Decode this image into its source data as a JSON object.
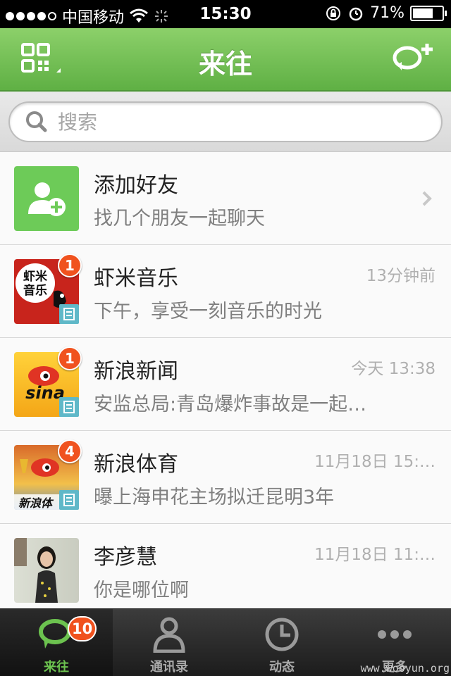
{
  "status_bar": {
    "carrier": "中国移动",
    "time": "15:30",
    "battery": "71%",
    "battery_level": 0.71
  },
  "navbar": {
    "title": "来往"
  },
  "search": {
    "placeholder": "搜索"
  },
  "conversations": [
    {
      "title": "添加好友",
      "subtitle": "找几个朋友一起聊天",
      "time": ""
    },
    {
      "title": "虾米音乐",
      "subtitle": "下午，享受一刻音乐的时光",
      "time": "13分钟前",
      "badge": "1",
      "avatar_text": "虾米\n音乐"
    },
    {
      "title": "新浪新闻",
      "subtitle": "安监总局:青岛爆炸事故是一起…",
      "time": "今天 13:38",
      "badge": "1",
      "avatar_text": "sina"
    },
    {
      "title": "新浪体育",
      "subtitle": "曝上海申花主场拟迁昆明3年",
      "time": "11月18日 15:…",
      "badge": "4",
      "avatar_text": "新浪体"
    },
    {
      "title": "李彦慧",
      "subtitle": "你是哪位啊",
      "time": "11月18日 11:…"
    }
  ],
  "tabs": [
    {
      "label": "来往",
      "badge": "10",
      "icon": "chat-bubble-icon"
    },
    {
      "label": "通讯录",
      "icon": "contacts-icon"
    },
    {
      "label": "动态",
      "icon": "clock-icon"
    },
    {
      "label": "更多",
      "icon": "more-icon"
    }
  ],
  "watermark": "www.wooyun.org",
  "colors": {
    "accent": "#6cc24f",
    "badge": "#f0521e",
    "navbar": "#5fb044"
  }
}
